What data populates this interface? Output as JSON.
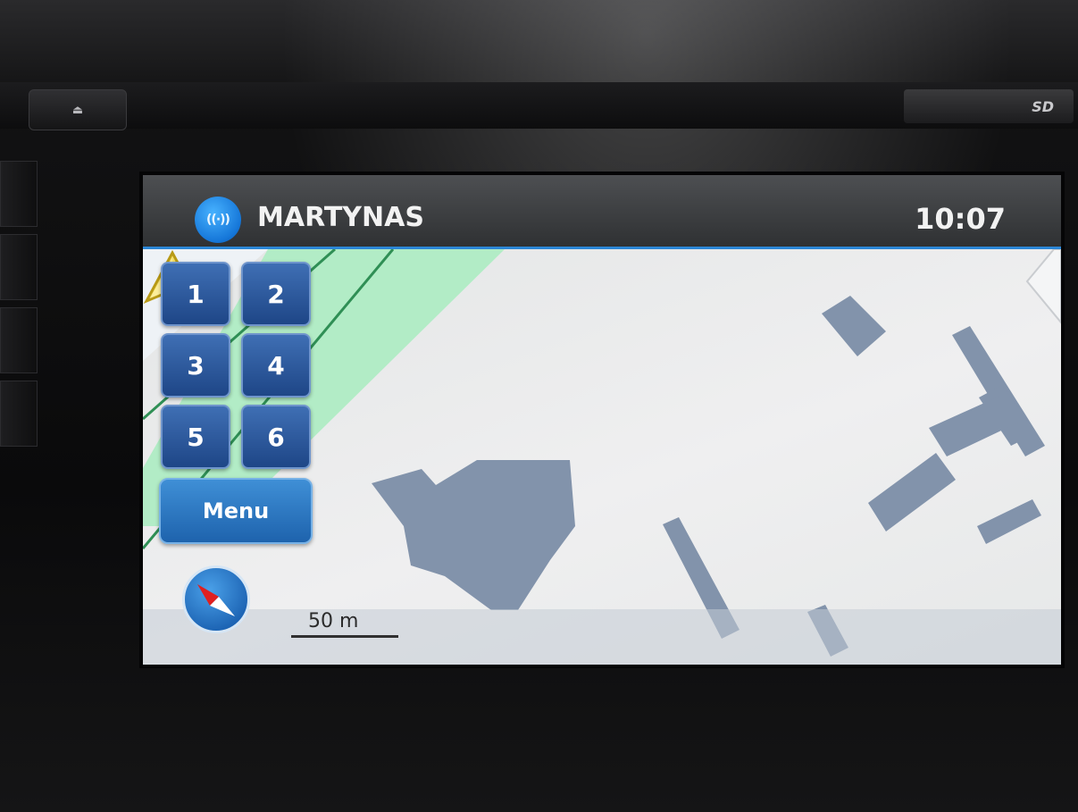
{
  "device": {
    "eject_icon": "eject-icon",
    "sd_label": "SD"
  },
  "header": {
    "status_icon": "bluetooth-signal-icon",
    "phone_name": "MARTYNAS",
    "clock": "10:07"
  },
  "presets": [
    "1",
    "2",
    "3",
    "4",
    "5",
    "6"
  ],
  "menu": {
    "label": "Menu"
  },
  "compass": {
    "icon": "compass-icon"
  },
  "map": {
    "scale_label": "50 m",
    "vehicle_icon": "vehicle-position-arrow-icon",
    "colors": {
      "building": "#8293ab",
      "park": "#a8ecbf",
      "road": "#2f8f55",
      "accent": "#2b86d6"
    }
  }
}
